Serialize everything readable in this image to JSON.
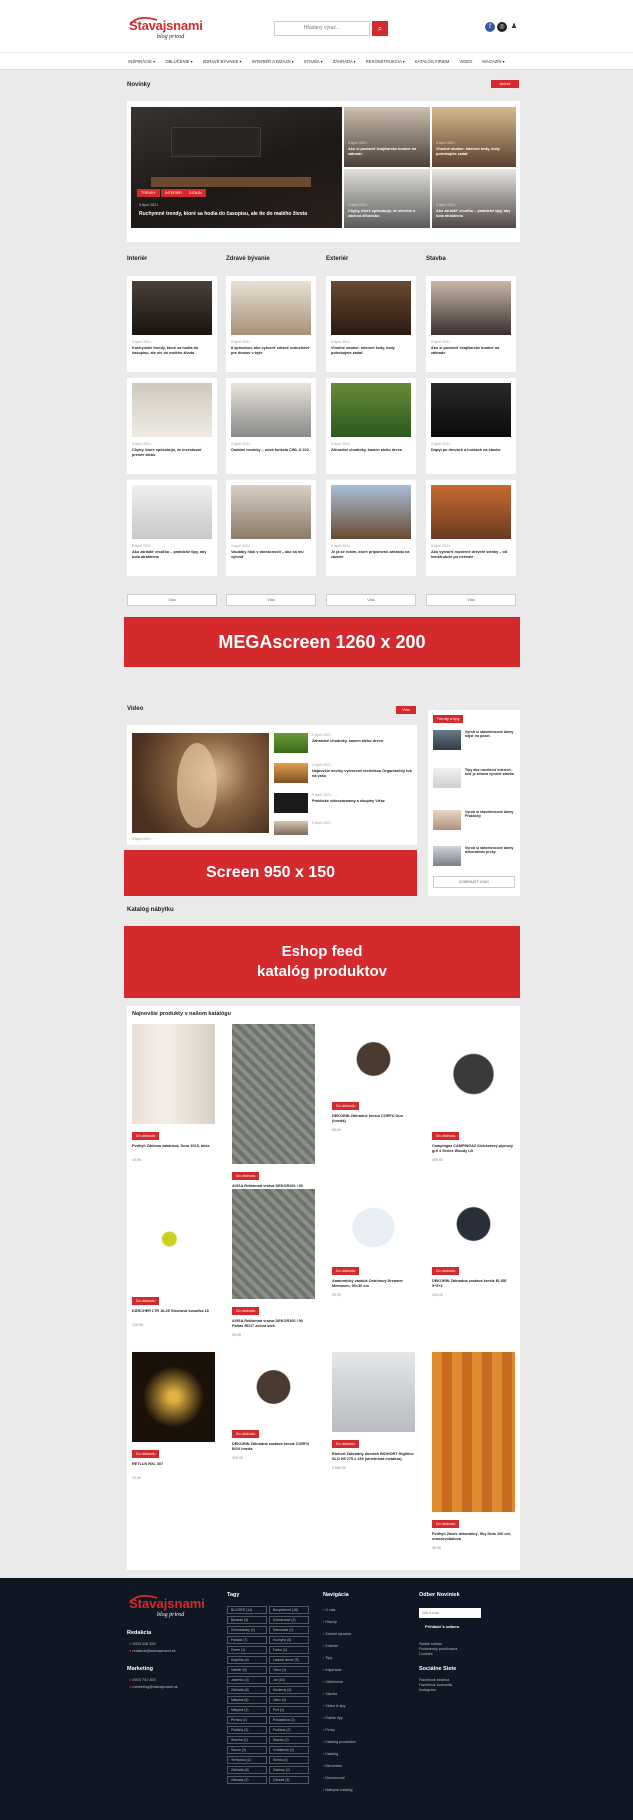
{
  "header": {
    "logo_text": "Stavajsnami",
    "logo_sub": "blog prirod",
    "search_placeholder": "Hľadaný výraz...",
    "search_icon": "search-icon"
  },
  "nav": [
    "INŠPIRÁCIE ▾",
    "OBLÚČENIE ▾",
    "ZDRAVÉ BÝVANIE ▾",
    "INTERIÉR A DIZAJN ▾",
    "STAVBA ▾",
    "ZÁHRADA ▾",
    "REKONŠTRUKCIA ▾",
    "KATALÓG FIRIEM",
    "VIDEO",
    "MAGAZÍN ▾"
  ],
  "novinky": {
    "title": "Novinky",
    "more": "Archív",
    "main_title": "Ruchymné trendy, ktoré sa hodia do časopisu, ale tie do malého života",
    "main_date": "9 Apríl 2021",
    "main_tags": [
      "TRENDY",
      "INTERIÉR",
      "DIZAJN"
    ],
    "side": [
      {
        "title": "Ako si postaviť švajčiarske bunker na záhrade",
        "date": "9 Apríl 2021"
      },
      {
        "title": "Vhodné studne: Internet kedy, kedy potrebujete zadať",
        "date": "9 Apríl 2021"
      },
      {
        "title": "Chyby, ktoré spôsobujú, že strecha a záchod dlhodobo",
        "date": "9 Apríl 2021"
      },
      {
        "title": "Ako zariadiť chuďbu – praktické tipy, aby bola atraktívna",
        "date": "9 Apríl 2021"
      }
    ]
  },
  "columns": [
    {
      "title": "Interiér",
      "items": [
        {
          "title": "Kuchynské trendy, ktoré sa hodia do časopisu, ale nie do malého života",
          "date": "9 Apríl 2021"
        },
        {
          "title": "Chyby, ktoré spôsobujú, že investovať presne alebo",
          "date": "9 Apríl 2021"
        },
        {
          "title": "Ako zariadiť chuďbu – praktické tipy, aby bola atraktívna",
          "date": "9 Apríl 2021"
        }
      ],
      "more": "Viac"
    },
    {
      "title": "Zdravé bývanie",
      "items": [
        {
          "title": "8 spôsobov, ako vytvoriť zdravé vzduchové pre domov v byte",
          "date": "9 Apríl 2021"
        },
        {
          "title": "Ostatné novinky – nová funkcia CWL-X 222",
          "date": "9 Apríl 2021"
        },
        {
          "title": "Vaudaky hluk v domácnosti – ako sa mu vyhnúť",
          "date": "9 Apríl 2021"
        }
      ],
      "more": "Viac"
    },
    {
      "title": "Exteriér",
      "items": [
        {
          "title": "Vhodné studne: Internet kedy, kedy potrebujete zadať",
          "date": "9 Apríl 2021"
        },
        {
          "title": "Záhradné chodníky, kamen alebo drevo",
          "date": "9 Apríl 2021"
        },
        {
          "title": "Je já se robím, ktoré pripomenú záhradu na zázemí",
          "date": "9 Apríl 2021"
        }
      ],
      "more": "Viac"
    },
    {
      "title": "Stavba",
      "items": [
        {
          "title": "Ako si postaviť švajčiarske bunker na záhrade",
          "date": "9 Apríl 2021"
        },
        {
          "title": "Dopyt po drevách a horkách na stavbe",
          "date": "9 Apríl 2021"
        },
        {
          "title": "Ako vytvoriť moderné dreveté stenky – od konštrukcie po riešenie",
          "date": "9 Apríl 2021"
        }
      ],
      "more": "Viac"
    }
  ],
  "mega_banner": "MEGAscreen 1260 x 200",
  "video": {
    "title": "Video",
    "more": "Viac",
    "list": [
      {
        "title": "Záhradné chodníky, kamen alebo drevo",
        "date": "9 Apríl 2021"
      },
      {
        "title": "Najnovšie noviny vytvorené technikou Organizačný tok na vašu",
        "date": "9 Apríl 2021"
      },
      {
        "title": "Praktické videozáznamy a skupiny Víťaz",
        "date": "9 Apríl 2021"
      },
      {
        "title": "Ako zariadiť moderné dom",
        "date": "9 Apríl 2021"
      }
    ],
    "main_date": "9 Apríl 2021",
    "main_title": "Vhodné studne: Internet kedy, kedy potrebujete zadať"
  },
  "screen_banner": "Screen 950 x 150",
  "right_box": {
    "tab": "Trendy a tipy",
    "items": [
      "Vyrob si stavebnicové domy nájsť na pozor.",
      "Tipy ako navrhnúť internet, keď je zdravá vyrobiť stavbu",
      "Vyrob si stavebnicové domy Praktický",
      "Vyrob si stavebnicové domy dekoratívne prvky"
    ],
    "more": "ZOBRAZIŤ VIAC"
  },
  "katalog": {
    "title": "Katalóg nábytku"
  },
  "eshop_banner_line1": "Eshop feed",
  "eshop_banner_line2": "katalóg produktov",
  "products": {
    "title": "Najnovšie produkty v našom katalógu",
    "tag": "Do obchodu",
    "items": [
      {
        "name": "Pvdhyň Záclona žakárová, Dora 1015, biela",
        "price": "49,90"
      },
      {
        "name": "AVISA Reklamná vrstva DEKOR100 / 90 Parlas RD17 zvetra sivá",
        "price": "59,90"
      },
      {
        "name": "DEKORIN Záhradné kreslo CORFU Duo (hnedá)",
        "price": "89,90"
      },
      {
        "name": "Campingaz CAMPINGAZ Klebšetový plynový gril 4 Series Woody LD",
        "price": "489,00"
      },
      {
        "name": "KÄRCHER LTR 18-25 Strunová kosačka 18",
        "price": "109,90"
      },
      {
        "name": "AVISA Reklamná vrstva DEKOR100 / 90 Parlas RD17 zvetra sivá",
        "price": "59,90"
      },
      {
        "name": "Anatomický vankúš Ostrinový Dreamer Memosen, 50×30 cm",
        "price": "29,90"
      },
      {
        "name": "DEKORIN Záhradná zostava kreslá ELISE 5+6+1",
        "price": "349,00"
      },
      {
        "name": "RETLUX RXL 307",
        "price": "19,90"
      },
      {
        "name": "DEKORIN Záhradná zostava kreslá CORFU BOX hnedá",
        "price": "329,00"
      },
      {
        "name": "Biohort Záhradný domček BIOHORT Highline SLO H5 275 x 235 (striebristá metalíza)",
        "price": "2 589,00"
      },
      {
        "name": "Pvdhyň Záves dekoračný, Sky Dots 100 cm, oranžovoladová",
        "price": "39,90"
      }
    ]
  },
  "footer": {
    "redakcia": "Redakcia",
    "phone1": "0903 446 399",
    "mail1": "redakcia@stavajsnami.sk",
    "marketing": "Marketing",
    "phone2": "0903 741 300",
    "mail2": "marketing@stavajsnami.sk",
    "tags_title": "Tagy",
    "tags": [
      "BLOGER (14)",
      "Bezpečnosť (18)",
      "Bývanie (3)",
      "Domácnosť (2)",
      "Drevostavby (2)",
      "Dekorácie (2)",
      "Fasáda (7)",
      "Kuchyňa (5)",
      "Dvere (1)",
      "Farba (3)",
      "Kúpeľňa (4)",
      "Ľadové dreve (9)",
      "Interiér (6)",
      "Okno (1)",
      "Jazierko (4)",
      "Jar (15)",
      "Záhrada (6)",
      "Moderný (4)",
      "Nábytok (6)",
      "Okno (5)",
      "Nábytok (2)",
      "Plot (4)",
      "Pivnica (2)",
      "Pokladnica (2)",
      "Podlahy (2)",
      "Podlaha (2)",
      "Strecha (2)",
      "Stavba (2)",
      "Sauna (3)",
      "Vzdialenia (2)",
      "Termoska (2)",
      "Skriňa (4)",
      "Záhrada (6)",
      "Záclony (2)",
      "Záhrady (2)",
      "Zdravie (3)"
    ],
    "nav_title": "Navigácia",
    "nav": [
      "O nás",
      "Hlavný",
      "Zdravé bývanie",
      "Exteriér",
      "Tipy",
      "Inšpirácie",
      "Obliečenie",
      "Stavba",
      "Video & tipy",
      "Ďalšie tipy",
      "Firmy",
      "Katalóg produktov",
      "Katalóg",
      "Mercedes",
      "Domácnosť",
      "Nábytok katalóg"
    ],
    "news_title": "Odber Noviniek",
    "news_placeholder": "Váš e-mail",
    "news_btn": "Prihlásiť k odberu",
    "news_links": [
      "Stažte súhlas",
      "Podmienky používania",
      "Cookies"
    ],
    "social_title": "Sociálne Siete",
    "social": [
      "Facebook stránka",
      "Facebook komunita",
      "Instagram"
    ]
  },
  "colors": {
    "accent": "#d42a2e",
    "footer": "#0f1724"
  }
}
